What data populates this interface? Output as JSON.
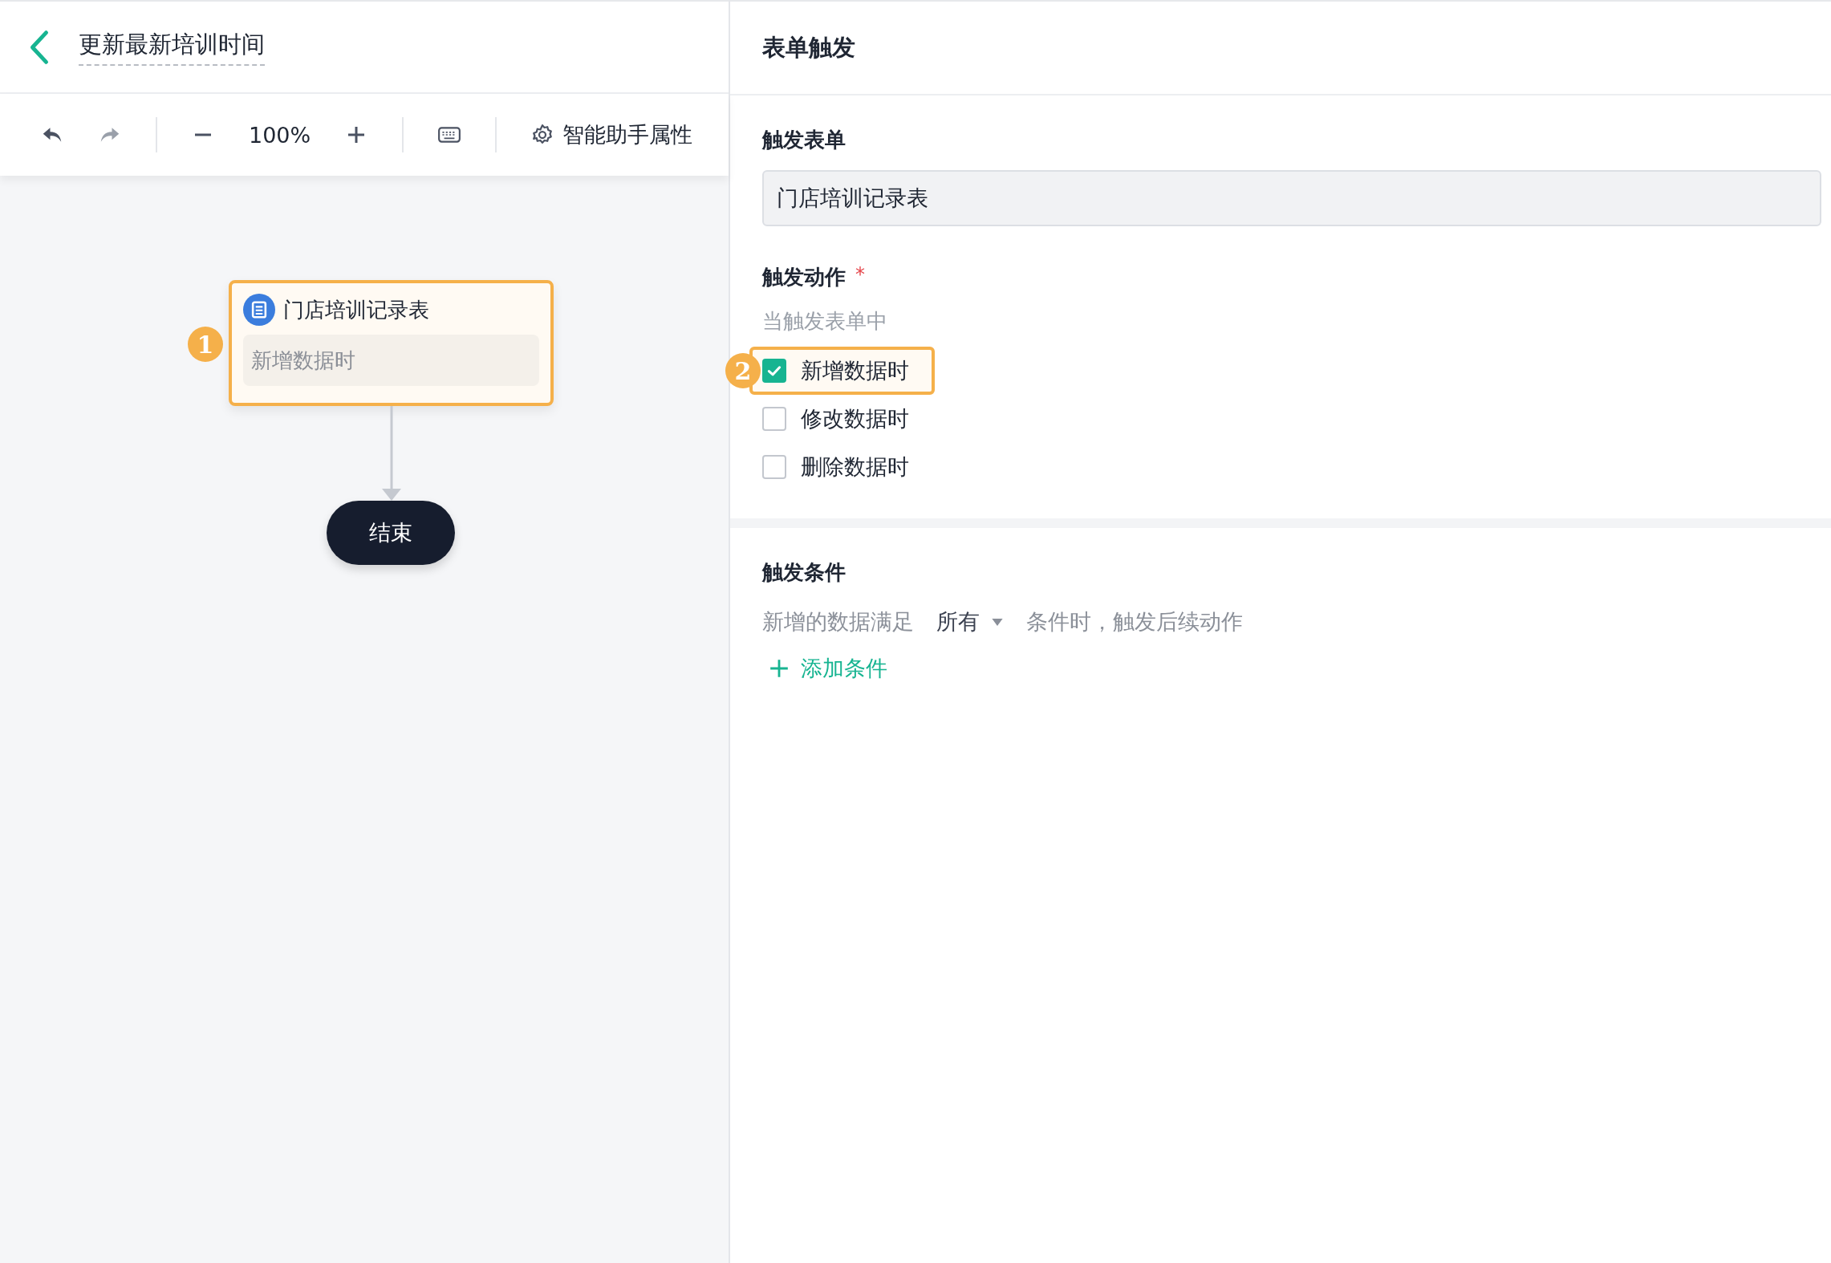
{
  "header": {
    "title": "更新最新培训时间"
  },
  "toolbar": {
    "zoom": "100%",
    "properties_button": "智能助手属性"
  },
  "canvas": {
    "nodes": [
      {
        "kind": "trigger",
        "title": "门店培训记录表",
        "subtitle": "新增数据时",
        "step": "1",
        "highlighted": true
      },
      {
        "kind": "end",
        "title": "结束"
      }
    ]
  },
  "panel": {
    "title": "表单触发",
    "trigger_form": {
      "label": "触发表单",
      "value": "门店培训记录表"
    },
    "trigger_action": {
      "label": "触发动作",
      "required_mark": "*",
      "hint": "当触发表单中",
      "options": [
        {
          "label": "新增数据时",
          "checked": true,
          "step": "2",
          "highlighted": true
        },
        {
          "label": "修改数据时",
          "checked": false,
          "highlighted": false
        },
        {
          "label": "删除数据时",
          "checked": false,
          "highlighted": false
        }
      ]
    },
    "trigger_condition": {
      "label": "触发条件",
      "prefix": "新增的数据满足",
      "match": "所有",
      "suffix": "条件时，触发后续动作",
      "add_button": "添加条件"
    }
  }
}
